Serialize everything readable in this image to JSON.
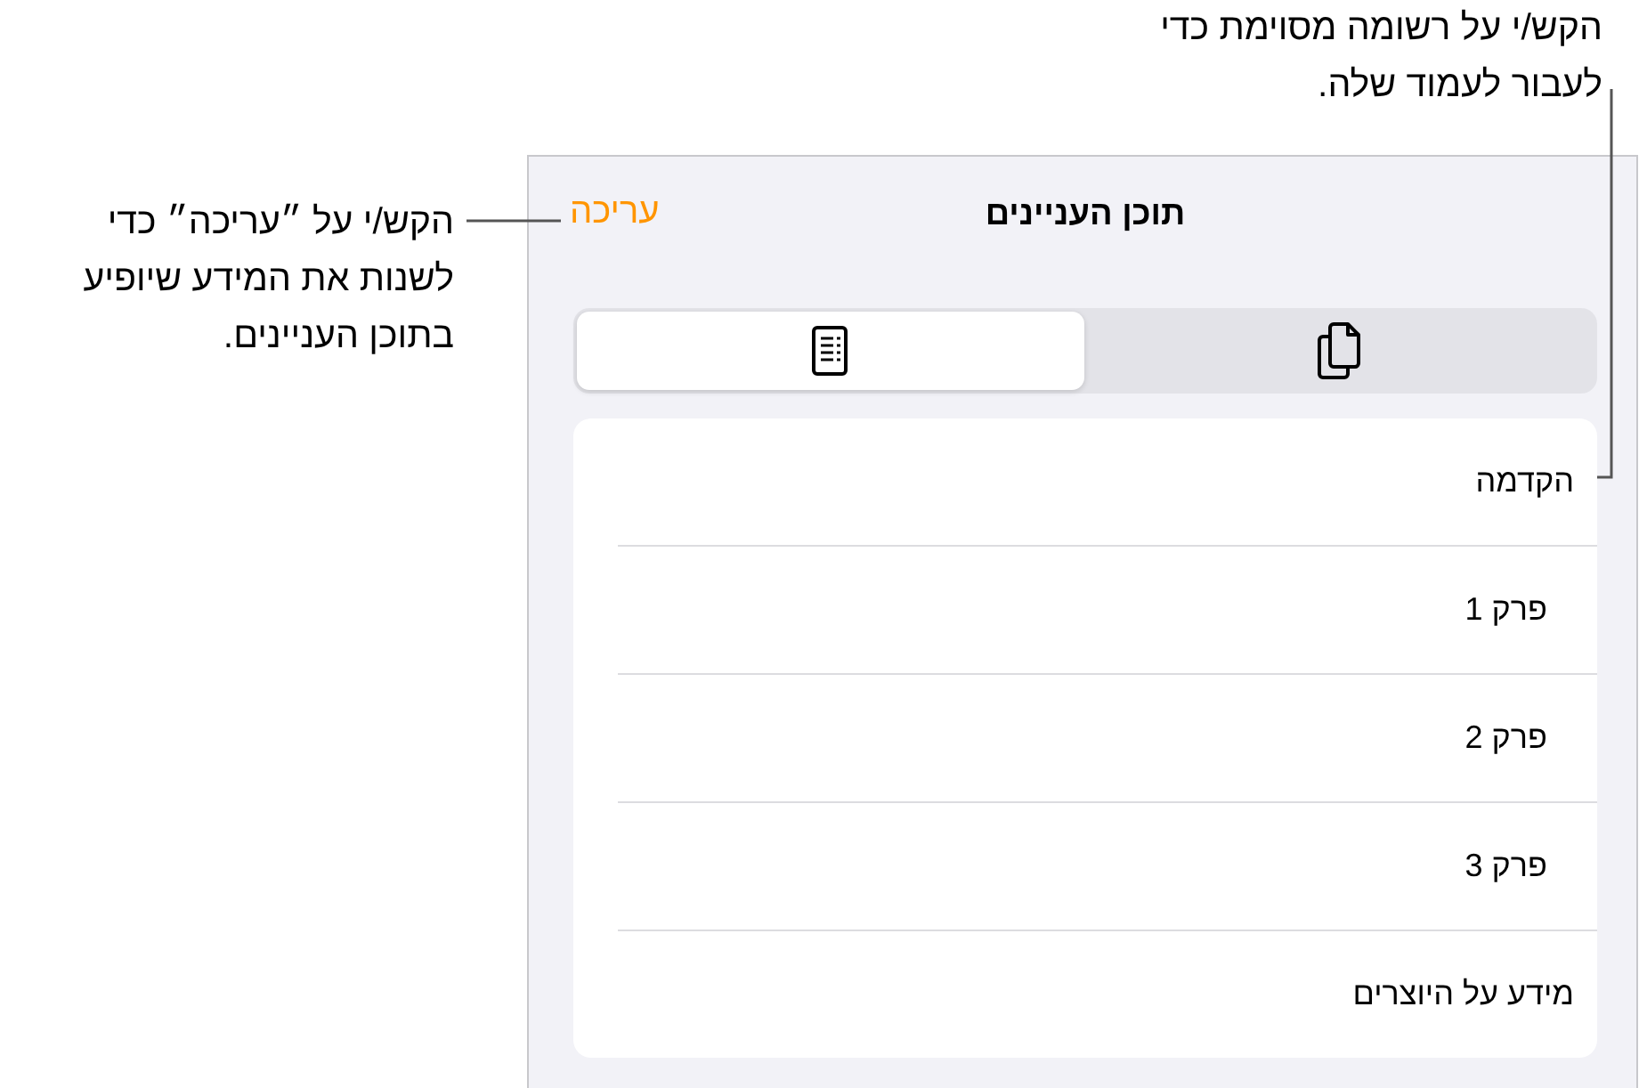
{
  "callouts": [
    {
      "text": "הקש/י על רשומה מסוימת כדי לעבור לעמוד שלה."
    },
    {
      "text": "הקש/י על ״עריכה״ כדי לשנות את המידע שיופיע בתוכן העניינים."
    }
  ],
  "panel": {
    "title": "תוכן העניינים",
    "edit_button": "עריכה",
    "tabs": [
      {
        "kind": "pages",
        "selected": false
      },
      {
        "kind": "toc",
        "selected": true
      }
    ],
    "entries": [
      {
        "label": "הקדמה",
        "children": [
          {
            "label": "פרק 1"
          },
          {
            "label": "פרק 2"
          },
          {
            "label": "פרק 3"
          }
        ]
      },
      {
        "label": "מידע על היוצרים"
      }
    ]
  }
}
